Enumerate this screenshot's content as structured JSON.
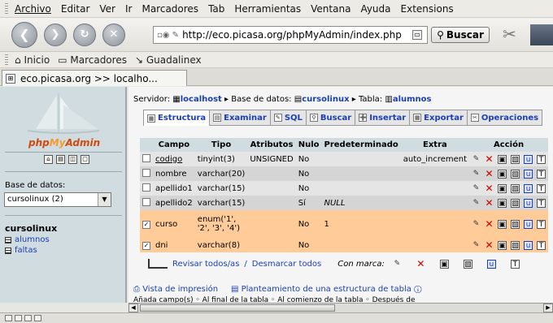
{
  "menubar": {
    "items": [
      "Archivo",
      "Editar",
      "Ver",
      "Ir",
      "Marcadores",
      "Tab",
      "Herramientas",
      "Ventana",
      "Ayuda",
      "Extensions"
    ]
  },
  "navbar": {
    "url": "http://eco.picasa.org/phpMyAdmin/index.php",
    "search_label": "Buscar"
  },
  "bookmarks": {
    "items": [
      "Inicio",
      "Marcadores",
      "Guadalinex"
    ]
  },
  "tab": {
    "title": "eco.picasa.org >> localho..."
  },
  "sidebar": {
    "logo_php": "php",
    "logo_my": "My",
    "logo_admin": "Admin",
    "db_label": "Base de datos:",
    "db_selected": "cursolinux (2)",
    "db_name": "cursolinux",
    "tables": [
      "alumnos",
      "faltas"
    ]
  },
  "breadcrumb": {
    "server_label": "Servidor:",
    "server": "localhost",
    "db_label": "Base de datos:",
    "db": "cursolinux",
    "table_label": "Tabla:",
    "table": "alumnos"
  },
  "tabs": [
    "Estructura",
    "Examinar",
    "SQL",
    "Buscar",
    "Insertar",
    "Exportar",
    "Operaciones"
  ],
  "table": {
    "headers": [
      "Campo",
      "Tipo",
      "Atributos",
      "Nulo",
      "Predeterminado",
      "Extra",
      "Acción"
    ],
    "rows": [
      {
        "campo": "codigo",
        "tipo": "tinyint(3)",
        "atributos": "UNSIGNED",
        "nulo": "No",
        "predeterminado": "",
        "extra": "auto_increment",
        "checked": ""
      },
      {
        "campo": "nombre",
        "tipo": "varchar(20)",
        "atributos": "",
        "nulo": "No",
        "predeterminado": "",
        "extra": "",
        "checked": ""
      },
      {
        "campo": "apellido1",
        "tipo": "varchar(15)",
        "atributos": "",
        "nulo": "No",
        "predeterminado": "",
        "extra": "",
        "checked": ""
      },
      {
        "campo": "apellido2",
        "tipo": "varchar(15)",
        "atributos": "",
        "nulo": "Sí",
        "predeterminado": "NULL",
        "extra": "",
        "checked": ""
      },
      {
        "campo": "curso",
        "tipo": "enum('1', '2', '3', '4')",
        "atributos": "",
        "nulo": "No",
        "predeterminado": "1",
        "extra": "",
        "checked": "✓"
      },
      {
        "campo": "dni",
        "tipo": "varchar(8)",
        "atributos": "",
        "nulo": "No",
        "predeterminado": "",
        "extra": "",
        "checked": "✓"
      }
    ]
  },
  "footer": {
    "check_all": "Revisar todos/as",
    "separator": "/",
    "uncheck_all": "Desmarcar todos",
    "with_selected": "Con marca:",
    "print_view": "Vista de impresión",
    "propose_structure": "Planteamiento de una estructura de tabla",
    "add_fields_line": "Añada    campo(s)   ◦ Al final de la tabla   ◦ Al comienzo de la tabla   ◦ Después de"
  }
}
